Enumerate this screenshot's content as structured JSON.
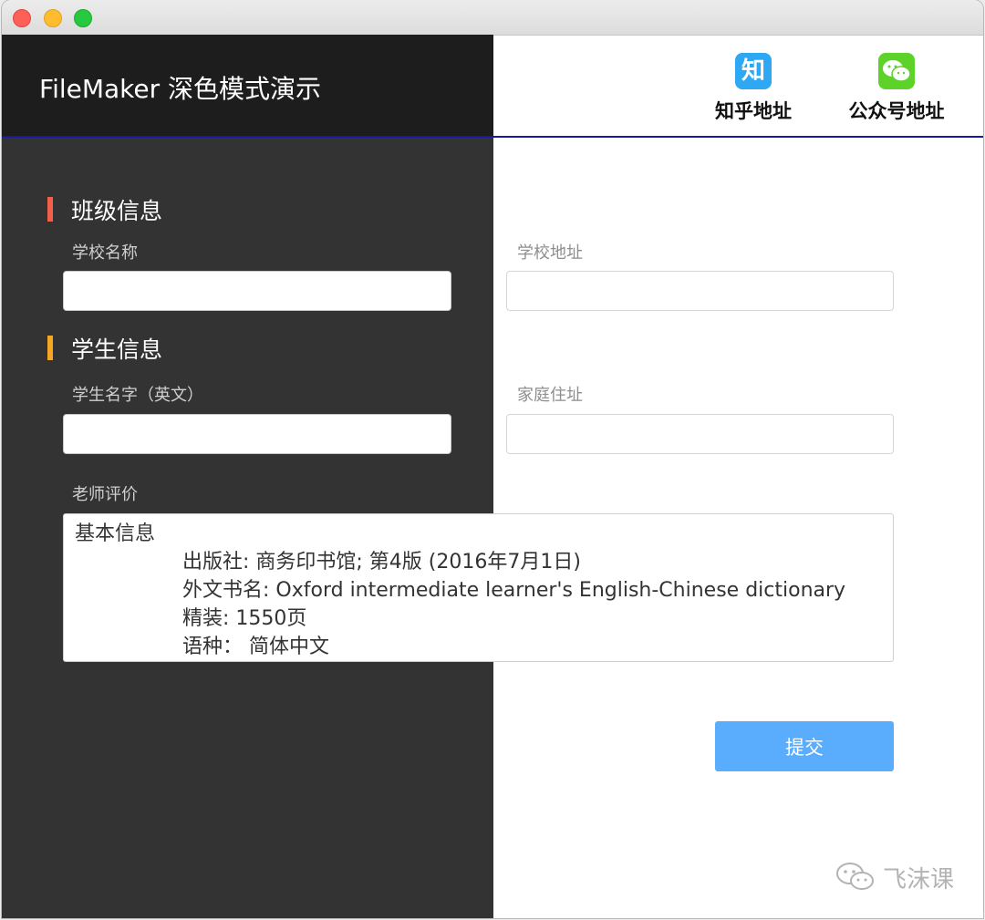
{
  "app": {
    "title": "FileMaker 深色模式演示"
  },
  "header_links": {
    "zhihu": {
      "icon": "zhihu-icon",
      "glyph": "知",
      "label": "知乎地址"
    },
    "wechat": {
      "icon": "wechat-icon",
      "label": "公众号地址"
    }
  },
  "sections": {
    "class_info": {
      "title": "班级信息",
      "accent": "#f2604a"
    },
    "student_info": {
      "title": "学生信息",
      "accent": "#f5a623"
    }
  },
  "fields": {
    "school_name": {
      "label": "学校名称",
      "value": ""
    },
    "school_address": {
      "label": "学校地址",
      "value": ""
    },
    "student_name": {
      "label": "学生名字（英文）",
      "value": ""
    },
    "home_address": {
      "label": "家庭住址",
      "value": ""
    },
    "teacher_comment": {
      "label": "老师评价",
      "lines": [
        "基本信息",
        "出版社: 商务印书馆; 第4版 (2016年7月1日)",
        "外文书名: Oxford intermediate learner's English-Chinese dictionary",
        "精装: 1550页",
        "语种：  简体中文"
      ]
    }
  },
  "actions": {
    "submit_label": "提交"
  },
  "watermark": {
    "text": "飞沫课",
    "icon": "wechat-logo-icon"
  },
  "colors": {
    "dark_panel": "#333333",
    "header_dark": "#1d1d1d",
    "header_divider": "#1a1aa0",
    "submit": "#5aacfc"
  }
}
